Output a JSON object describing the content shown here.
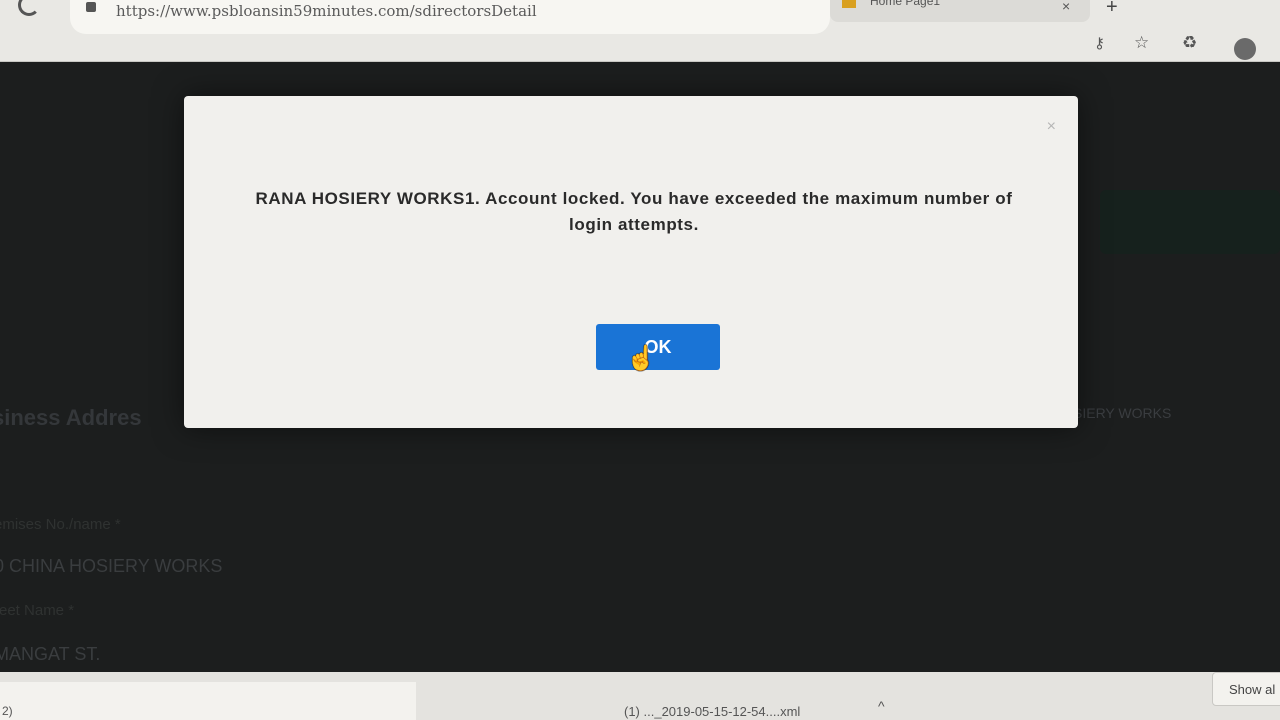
{
  "browser": {
    "url": "https://www.psbloansin59minutes.com/sdirectorsDetail",
    "tab_title": "Home Page1",
    "tab_close": "×",
    "new_tab": "+",
    "icons": [
      "reload-icon",
      "lock-icon",
      "key-icon",
      "star-icon",
      "extension-icon",
      "profile-avatar"
    ]
  },
  "background_page": {
    "section_heading": "siness Addres",
    "right_label": "RANA HOSIERY WORKS",
    "field1_label": "emises No./name *",
    "field1_value": "0 CHINA HOSIERY WORKS",
    "field2_label": "reet Name *",
    "field2_value": "MANGAT ST."
  },
  "modal": {
    "close": "×",
    "message": "RANA HOSIERY WORKS1. Account locked. You have exceeded the maximum number of login attempts.",
    "ok_label": "OK",
    "ok_color": "#1a74d6"
  },
  "downloads": {
    "left_item_text": "2)",
    "file_name": "(1)  ..._2019-05-15-12-54....xml",
    "chevron": "^",
    "show_all_label": "Show al"
  }
}
